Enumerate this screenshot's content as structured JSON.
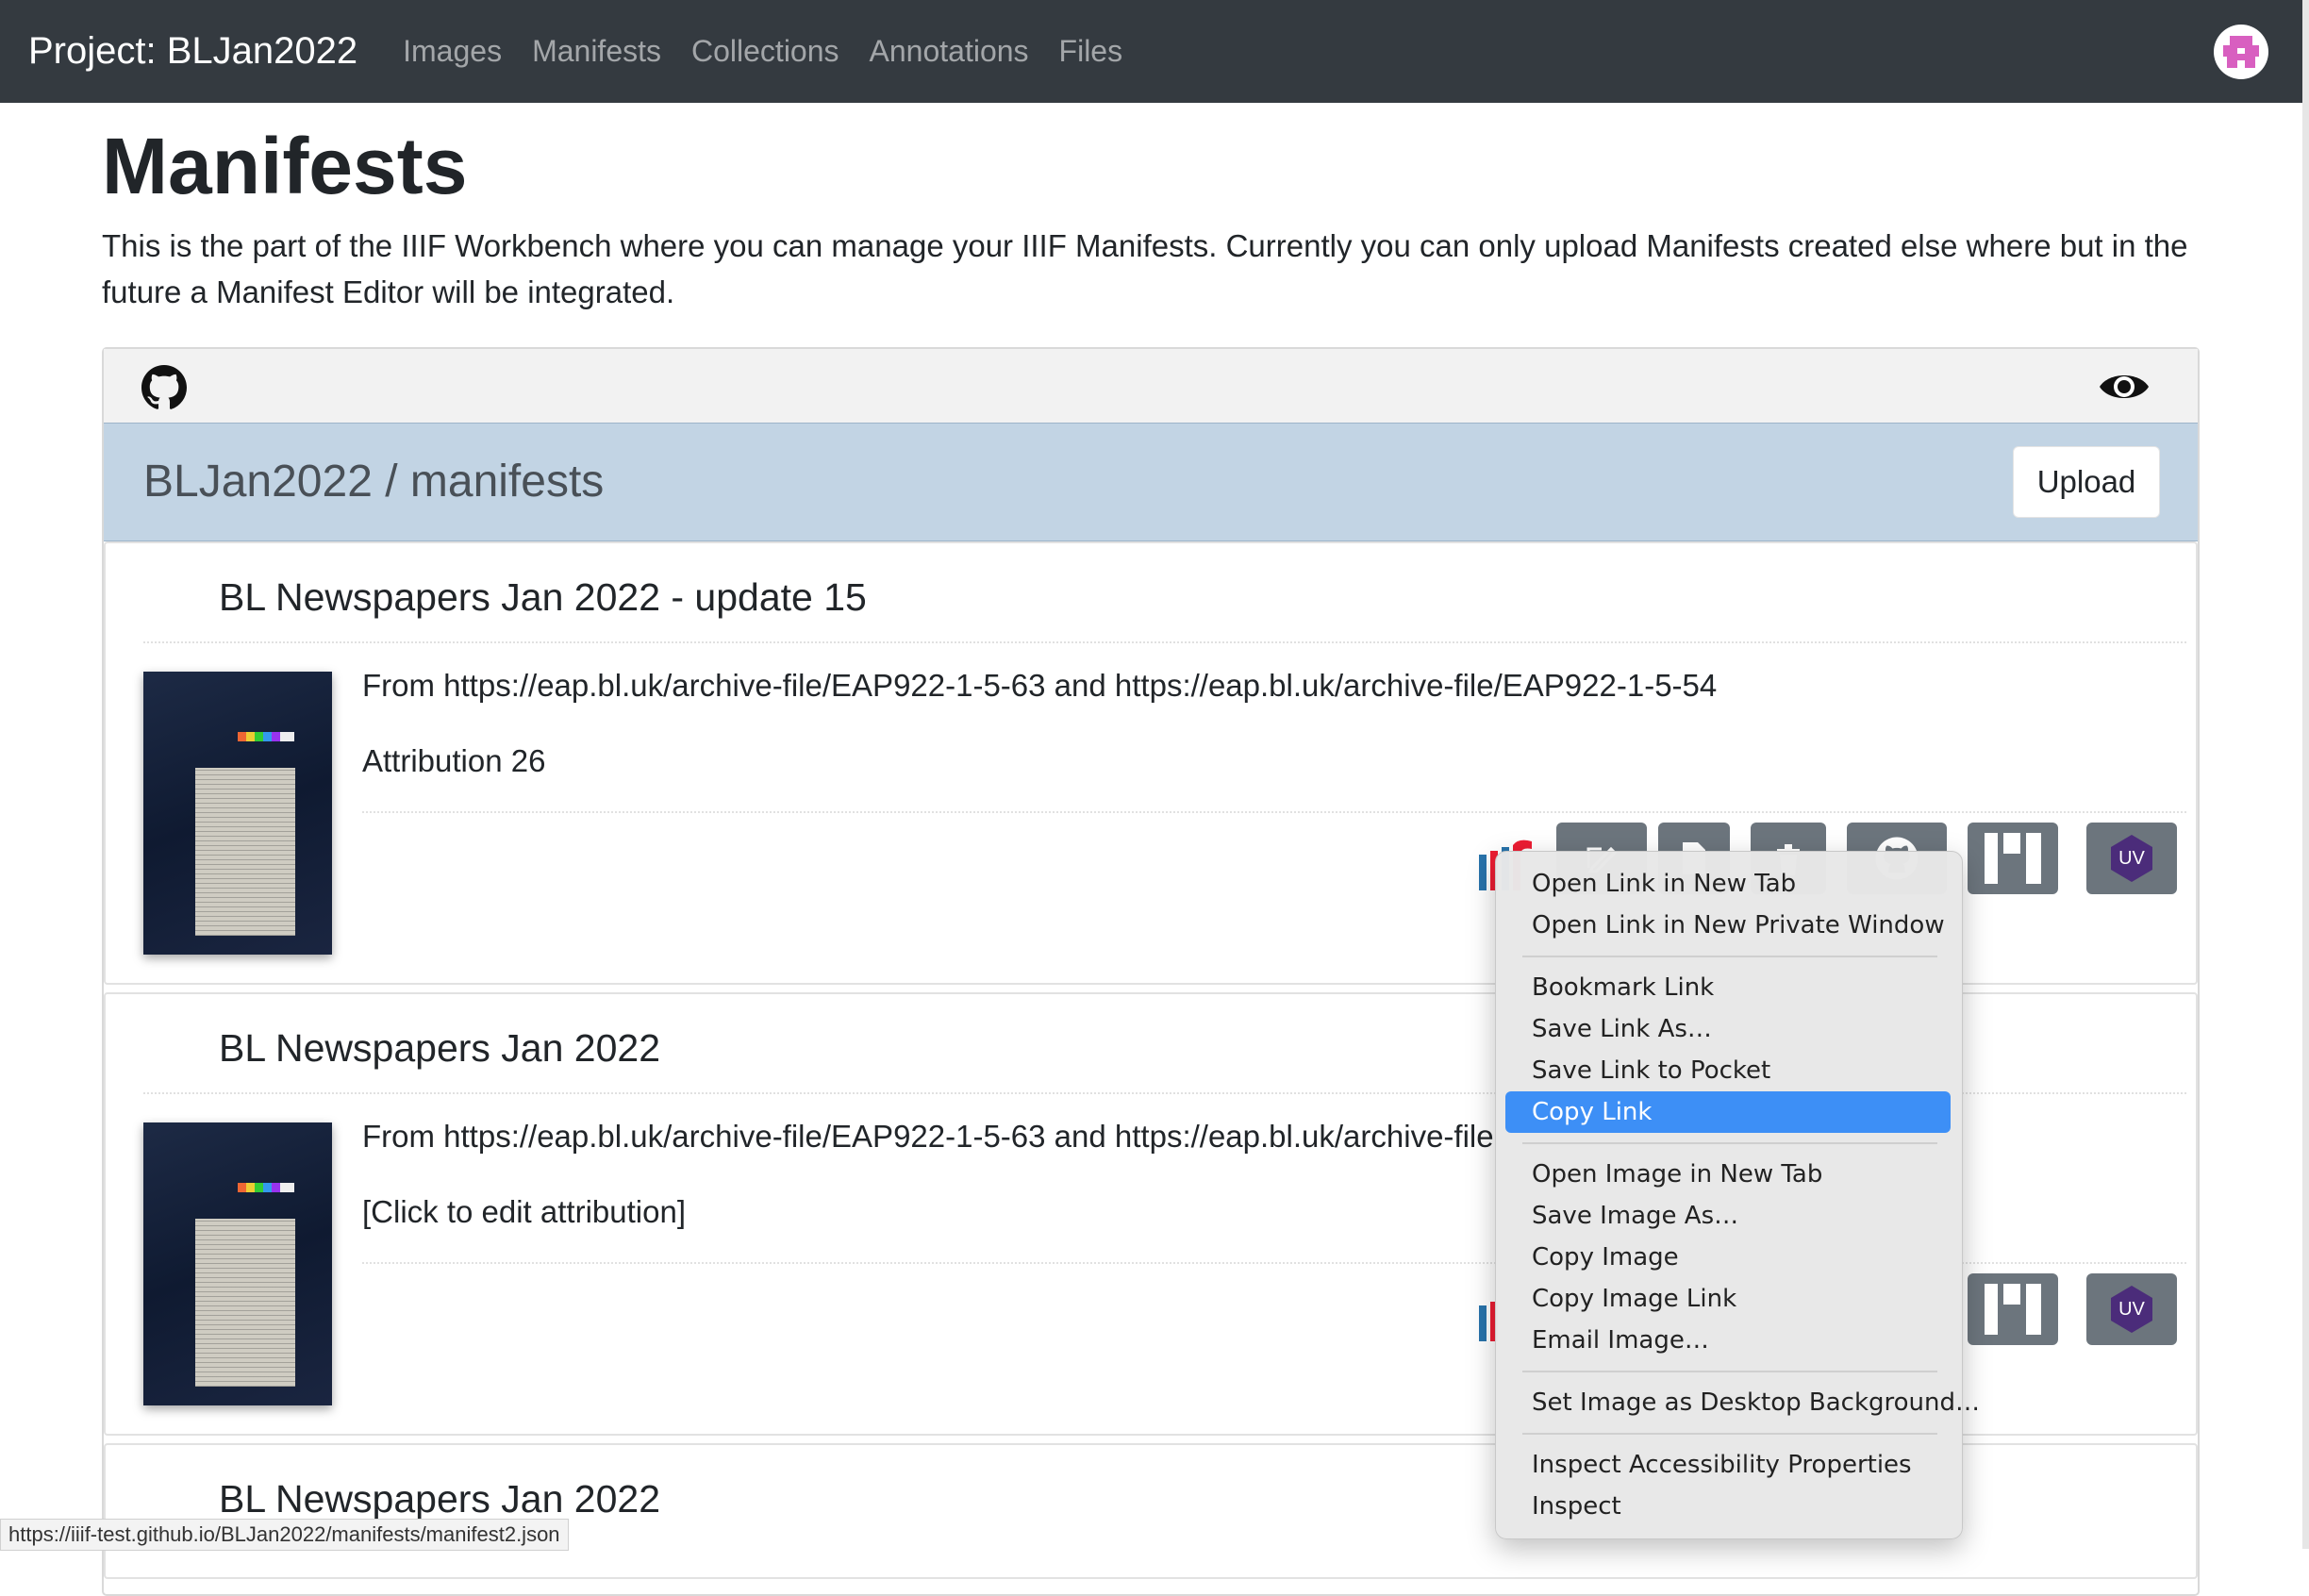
{
  "navbar": {
    "brand": "Project: BLJan2022",
    "links": [
      "Images",
      "Manifests",
      "Collections",
      "Annotations",
      "Files"
    ]
  },
  "page": {
    "title": "Manifests",
    "intro": "This is the part of the IIIF Workbench where you can manage your IIIF Manifests. Currently you can only upload Manifests created else where but in the future a Manifest Editor will be integrated."
  },
  "repo": {
    "title": "BLJan2022 / manifests",
    "upload_label": "Upload"
  },
  "manifests": [
    {
      "title": "BL Newspapers Jan 2022 - update 15",
      "description": "From https://eap.bl.uk/archive-file/EAP922-1-5-63 and https://eap.bl.uk/archive-file/EAP922-1-5-54",
      "attribution": "Attribution 26"
    },
    {
      "title": "BL Newspapers Jan 2022",
      "description": "From https://eap.bl.uk/archive-file/EAP922-1-5-63 and https://eap.bl.uk/archive-file",
      "attribution": "[Click to edit attribution]"
    },
    {
      "title": "BL Newspapers Jan 2022"
    }
  ],
  "uv_label": "UV",
  "context_menu": {
    "items": [
      "Open Link in New Tab",
      "Open Link in New Private Window",
      "Bookmark Link",
      "Save Link As…",
      "Save Link to Pocket",
      "Copy Link",
      "Open Image in New Tab",
      "Save Image As…",
      "Copy Image",
      "Copy Image Link",
      "Email Image…",
      "Set Image as Desktop Background…",
      "Inspect Accessibility Properties",
      "Inspect"
    ],
    "highlighted": "Copy Link"
  },
  "status_url": "https://iiif-test.github.io/BLJan2022/manifests/manifest2.json",
  "colors": {
    "navbar": "#343a40",
    "repo_bar": "#c2d4e4",
    "action_button": "#6c757d",
    "uv_badge": "#4b2c7a",
    "highlight": "#3d8ff6"
  }
}
